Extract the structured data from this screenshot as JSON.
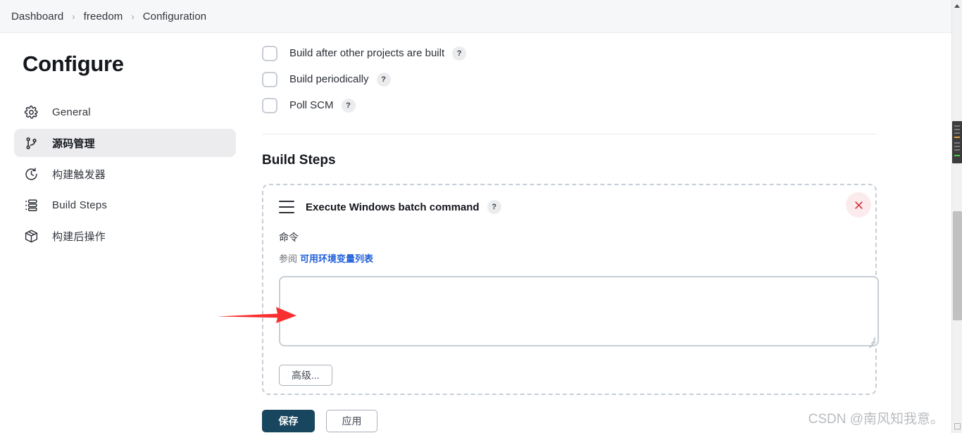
{
  "breadcrumb": {
    "items": [
      "Dashboard",
      "freedom",
      "Configuration"
    ],
    "separator": "›"
  },
  "sidebar": {
    "title": "Configure",
    "items": [
      {
        "label": "General",
        "icon": "gear-icon",
        "active": false
      },
      {
        "label": "源码管理",
        "icon": "git-branch-icon",
        "active": true
      },
      {
        "label": "构建触发器",
        "icon": "clock-icon",
        "active": false
      },
      {
        "label": "Build Steps",
        "icon": "list-steps-icon",
        "active": false
      },
      {
        "label": "构建后操作",
        "icon": "package-icon",
        "active": false
      }
    ]
  },
  "triggers": {
    "items": [
      {
        "label": "Build after other projects are built",
        "checked": false,
        "help": "?"
      },
      {
        "label": "Build periodically",
        "checked": false,
        "help": "?"
      },
      {
        "label": "Poll SCM",
        "checked": false,
        "help": "?"
      }
    ]
  },
  "build_steps": {
    "section_title": "Build Steps",
    "step": {
      "title": "Execute Windows batch command",
      "help": "?",
      "delete_label": "×",
      "command_label": "命令",
      "hint_prefix": "参阅",
      "hint_link": "可用环境变量列表",
      "command_value": "",
      "advanced_label": "高级..."
    }
  },
  "footer": {
    "save_label": "保存",
    "apply_label": "应用"
  },
  "watermark": {
    "text": "CSDN @南风知我意。"
  },
  "colors": {
    "accent_primary": "#18465f",
    "link": "#1f5ed8",
    "delete": "#d93843",
    "annotation_arrow": "#fa2f2f",
    "active_nav_bg": "#ececee"
  }
}
